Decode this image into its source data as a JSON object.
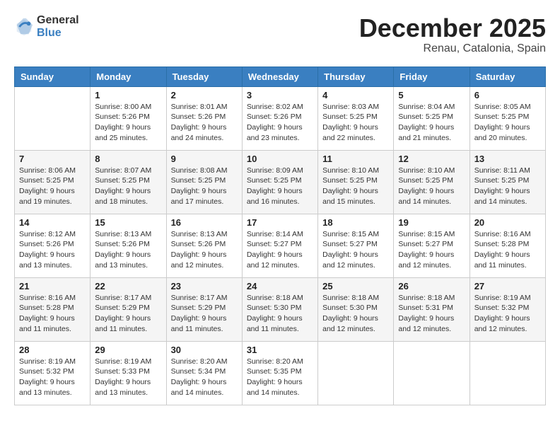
{
  "header": {
    "logo_general": "General",
    "logo_blue": "Blue",
    "month": "December 2025",
    "location": "Renau, Catalonia, Spain"
  },
  "weekdays": [
    "Sunday",
    "Monday",
    "Tuesday",
    "Wednesday",
    "Thursday",
    "Friday",
    "Saturday"
  ],
  "weeks": [
    [
      {
        "day": "",
        "info": ""
      },
      {
        "day": "1",
        "info": "Sunrise: 8:00 AM\nSunset: 5:26 PM\nDaylight: 9 hours\nand 25 minutes."
      },
      {
        "day": "2",
        "info": "Sunrise: 8:01 AM\nSunset: 5:26 PM\nDaylight: 9 hours\nand 24 minutes."
      },
      {
        "day": "3",
        "info": "Sunrise: 8:02 AM\nSunset: 5:26 PM\nDaylight: 9 hours\nand 23 minutes."
      },
      {
        "day": "4",
        "info": "Sunrise: 8:03 AM\nSunset: 5:25 PM\nDaylight: 9 hours\nand 22 minutes."
      },
      {
        "day": "5",
        "info": "Sunrise: 8:04 AM\nSunset: 5:25 PM\nDaylight: 9 hours\nand 21 minutes."
      },
      {
        "day": "6",
        "info": "Sunrise: 8:05 AM\nSunset: 5:25 PM\nDaylight: 9 hours\nand 20 minutes."
      }
    ],
    [
      {
        "day": "7",
        "info": "Sunrise: 8:06 AM\nSunset: 5:25 PM\nDaylight: 9 hours\nand 19 minutes."
      },
      {
        "day": "8",
        "info": "Sunrise: 8:07 AM\nSunset: 5:25 PM\nDaylight: 9 hours\nand 18 minutes."
      },
      {
        "day": "9",
        "info": "Sunrise: 8:08 AM\nSunset: 5:25 PM\nDaylight: 9 hours\nand 17 minutes."
      },
      {
        "day": "10",
        "info": "Sunrise: 8:09 AM\nSunset: 5:25 PM\nDaylight: 9 hours\nand 16 minutes."
      },
      {
        "day": "11",
        "info": "Sunrise: 8:10 AM\nSunset: 5:25 PM\nDaylight: 9 hours\nand 15 minutes."
      },
      {
        "day": "12",
        "info": "Sunrise: 8:10 AM\nSunset: 5:25 PM\nDaylight: 9 hours\nand 14 minutes."
      },
      {
        "day": "13",
        "info": "Sunrise: 8:11 AM\nSunset: 5:25 PM\nDaylight: 9 hours\nand 14 minutes."
      }
    ],
    [
      {
        "day": "14",
        "info": "Sunrise: 8:12 AM\nSunset: 5:26 PM\nDaylight: 9 hours\nand 13 minutes."
      },
      {
        "day": "15",
        "info": "Sunrise: 8:13 AM\nSunset: 5:26 PM\nDaylight: 9 hours\nand 13 minutes."
      },
      {
        "day": "16",
        "info": "Sunrise: 8:13 AM\nSunset: 5:26 PM\nDaylight: 9 hours\nand 12 minutes."
      },
      {
        "day": "17",
        "info": "Sunrise: 8:14 AM\nSunset: 5:27 PM\nDaylight: 9 hours\nand 12 minutes."
      },
      {
        "day": "18",
        "info": "Sunrise: 8:15 AM\nSunset: 5:27 PM\nDaylight: 9 hours\nand 12 minutes."
      },
      {
        "day": "19",
        "info": "Sunrise: 8:15 AM\nSunset: 5:27 PM\nDaylight: 9 hours\nand 12 minutes."
      },
      {
        "day": "20",
        "info": "Sunrise: 8:16 AM\nSunset: 5:28 PM\nDaylight: 9 hours\nand 11 minutes."
      }
    ],
    [
      {
        "day": "21",
        "info": "Sunrise: 8:16 AM\nSunset: 5:28 PM\nDaylight: 9 hours\nand 11 minutes."
      },
      {
        "day": "22",
        "info": "Sunrise: 8:17 AM\nSunset: 5:29 PM\nDaylight: 9 hours\nand 11 minutes."
      },
      {
        "day": "23",
        "info": "Sunrise: 8:17 AM\nSunset: 5:29 PM\nDaylight: 9 hours\nand 11 minutes."
      },
      {
        "day": "24",
        "info": "Sunrise: 8:18 AM\nSunset: 5:30 PM\nDaylight: 9 hours\nand 11 minutes."
      },
      {
        "day": "25",
        "info": "Sunrise: 8:18 AM\nSunset: 5:30 PM\nDaylight: 9 hours\nand 12 minutes."
      },
      {
        "day": "26",
        "info": "Sunrise: 8:18 AM\nSunset: 5:31 PM\nDaylight: 9 hours\nand 12 minutes."
      },
      {
        "day": "27",
        "info": "Sunrise: 8:19 AM\nSunset: 5:32 PM\nDaylight: 9 hours\nand 12 minutes."
      }
    ],
    [
      {
        "day": "28",
        "info": "Sunrise: 8:19 AM\nSunset: 5:32 PM\nDaylight: 9 hours\nand 13 minutes."
      },
      {
        "day": "29",
        "info": "Sunrise: 8:19 AM\nSunset: 5:33 PM\nDaylight: 9 hours\nand 13 minutes."
      },
      {
        "day": "30",
        "info": "Sunrise: 8:20 AM\nSunset: 5:34 PM\nDaylight: 9 hours\nand 14 minutes."
      },
      {
        "day": "31",
        "info": "Sunrise: 8:20 AM\nSunset: 5:35 PM\nDaylight: 9 hours\nand 14 minutes."
      },
      {
        "day": "",
        "info": ""
      },
      {
        "day": "",
        "info": ""
      },
      {
        "day": "",
        "info": ""
      }
    ]
  ]
}
